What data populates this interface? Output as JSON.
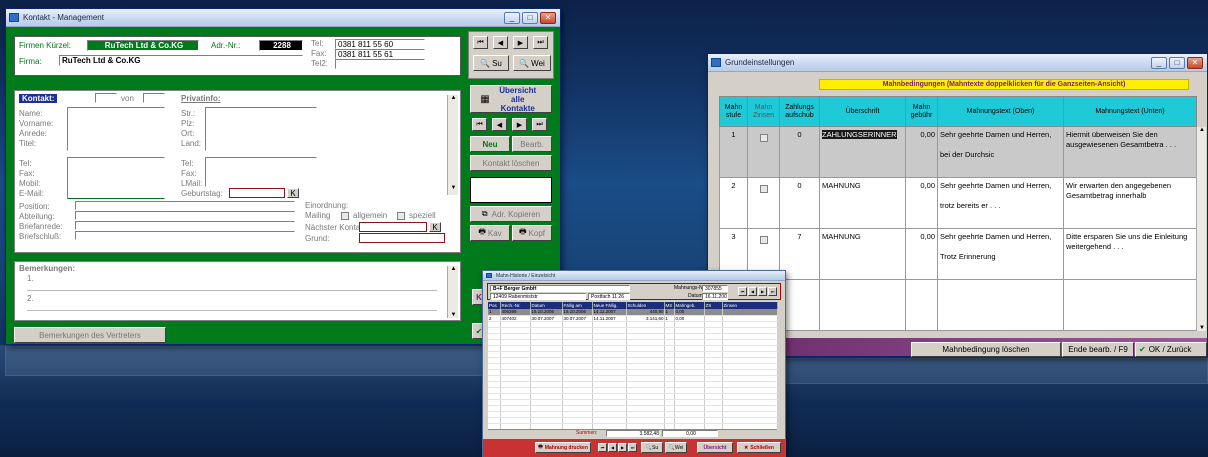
{
  "kontakt_window": {
    "title": "Kontakt - Management",
    "firmen_kuerzel_label": "Firmen Kürzel:",
    "firmen_kuerzel_value": "RuTech Ltd & Co.KG",
    "adr_nr_label": "Adr.-Nr.:",
    "adr_nr_value": "2288",
    "firma_label": "Firma:",
    "firma_value": "RuTech Ltd & Co.KG",
    "tel_label": "Tel:",
    "tel_value": "0381 811 55 60",
    "fax_label": "Fax:",
    "fax_value": "0381 811 55 61",
    "tel2_label": "Tel2:",
    "such_label": "Su",
    "wei_label": "Wei",
    "kontakt_label": "Kontakt:",
    "von_label": "von",
    "privatinfo_label": "Privatinfo:",
    "left_labels": [
      "Name:",
      "Vorname:",
      "Anrede:",
      "Titel:",
      "Tel:",
      "Fax:",
      "Mobil:",
      "E-Mail:",
      "Position:",
      "Abteilung:",
      "Briefanrede:",
      "Briefschluß:"
    ],
    "private_labels": [
      "Str.:",
      "Plz:",
      "Ort:",
      "Land:",
      "Tel:",
      "Fax:",
      "LMail:",
      "Geburtstag:"
    ],
    "k_label": "K",
    "einordnung_label": "Einordnung:",
    "mailing_label": "Mailing",
    "allgemein_label": "allgemein",
    "speziell_label": "speziell",
    "naechster_kontakt_label": "Nächster Kontakt:",
    "grund_label": "Grund:",
    "bemerkungen_label": "Bemerkungen:",
    "bem_items": [
      "1.",
      "2."
    ],
    "bemerkungen_vertreter_button": "Bemerkungen des Vertreters",
    "uebersicht_button": "Übersicht alle Kontakte",
    "neu_button": "Neu",
    "bearb_button": "Bearb.",
    "kontakt_loeschen_button": "Kontakt löschen",
    "adr_kopieren_button": "Adr. Kopieren",
    "kav_button": "Kav",
    "kopf_button": "Kopf",
    "side_letter": "K"
  },
  "grund_window": {
    "title": "Grundeinstellungen",
    "banner": "Mahnbedingungen  (Mahntexte doppelklicken für die Ganzseiten-Ansicht)",
    "headers": [
      "Mahn stufe",
      "Mahn Zinsen",
      "Zahlungs aufschub",
      "Überschrift",
      "Mahn gebühr",
      "Mahnungstext (Oben)",
      "Mahnungstext (Unten)"
    ],
    "rows": [
      {
        "stufe": "1",
        "aufschub": "0",
        "ueberschrift": "ZAHLUNGSERINNER",
        "gebuehr": "0,00",
        "oben": "Sehr geehrte Damen und Herren,\n\nbei der Durchsic",
        "unten": "Hiermit überweisen Sie den ausgewiesenen Gesamtbetra . . ."
      },
      {
        "stufe": "2",
        "aufschub": "0",
        "ueberschrift": "MAHNUNG",
        "gebuehr": "0,00",
        "oben": "Sehr geehrte Damen und Herren,\n\ntrotz bereits er . . .",
        "unten": "Wir erwarten den angegebenen Gesamtbetrag innerhalb"
      },
      {
        "stufe": "3",
        "aufschub": "7",
        "ueberschrift": "MAHNUNG",
        "gebuehr": "0,00",
        "oben": "Sehr geehrte Damen und Herren,\n\nTrotz Erinnerung",
        "unten": "Ditte ersparen Sie uns die Einleitung weitergehend . . ."
      }
    ],
    "mahnbedingung_loeschen": "Mahnbedingung löschen",
    "ende_bearb": "Ende bearb. / F9",
    "ok_zurueck": "OK / Zurück"
  },
  "historie_window": {
    "title": "Mahn-Historie / Einzelsicht",
    "firma": "B+F Berger GmbH",
    "adresse": "12409 Rabenmiststr",
    "postfach": "Postfach 11 26",
    "mahnungs_nr_label": "Mahnungs-Nr:",
    "mahnungs_nr_value": "307855",
    "datum_label": "Datum:",
    "datum_value": "16.11.2007",
    "headers": [
      "Pos",
      "Rech.-Nr.",
      "Datum",
      "Fällig am",
      "Neue Fällig.",
      "Schulden",
      "MS",
      "Mahngeb.",
      "ZS",
      "Zinsen"
    ],
    "rows": [
      [
        "1",
        "406399",
        "16.10.2006",
        "16.10.2006",
        "14.11.2007",
        "440,90",
        "1",
        "0,00",
        "",
        ""
      ],
      [
        "2",
        "407402",
        "30.07.2007",
        "30.07.2007",
        "14.11.2007",
        "3.141,60",
        "1",
        "0,00",
        "",
        ""
      ]
    ],
    "summen_label": "Summen:",
    "summe_schulden": "3.582,48",
    "summe_gebuehr": "0,00",
    "mahnung_drucken": "Mahnung drucken",
    "su_label": "Su",
    "wei_label": "Wei",
    "uebersicht": "Übersicht",
    "schliessen": "Schließen"
  }
}
